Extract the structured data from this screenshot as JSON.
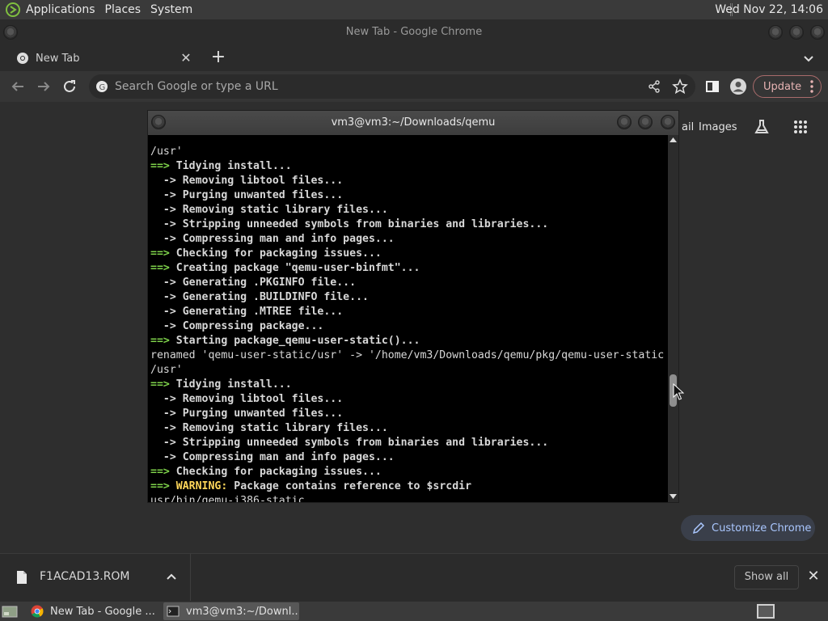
{
  "top_panel": {
    "menus": [
      "Applications",
      "Places",
      "System"
    ],
    "clock": "Wed Nov 22, 14:06"
  },
  "chrome": {
    "window_title": "New Tab - Google Chrome",
    "tab_title": "New Tab",
    "omnibox_placeholder": "Search Google or type a URL",
    "update_label": "Update",
    "gmail_fragment": "ail",
    "images_link": "Images",
    "customize_label": "Customize Chrome",
    "download": {
      "filename": "F1ACAD13.ROM",
      "show_all": "Show all"
    }
  },
  "terminal": {
    "title": "vm3@vm3:~/Downloads/qemu",
    "lines": [
      {
        "text": "                                                         ",
        "type": "plain"
      },
      {
        "text": "/usr'",
        "type": "plain"
      },
      {
        "text": "==> Tidying install...",
        "type": "step"
      },
      {
        "text": "  -> Removing libtool files...",
        "type": "sub"
      },
      {
        "text": "  -> Purging unwanted files...",
        "type": "sub"
      },
      {
        "text": "  -> Removing static library files...",
        "type": "sub"
      },
      {
        "text": "  -> Stripping unneeded symbols from binaries and libraries...",
        "type": "sub"
      },
      {
        "text": "  -> Compressing man and info pages...",
        "type": "sub"
      },
      {
        "text": "==> Checking for packaging issues...",
        "type": "step"
      },
      {
        "text": "==> Creating package \"qemu-user-binfmt\"...",
        "type": "step"
      },
      {
        "text": "  -> Generating .PKGINFO file...",
        "type": "sub"
      },
      {
        "text": "  -> Generating .BUILDINFO file...",
        "type": "sub"
      },
      {
        "text": "  -> Generating .MTREE file...",
        "type": "sub"
      },
      {
        "text": "  -> Compressing package...",
        "type": "sub"
      },
      {
        "text": "==> Starting package_qemu-user-static()...",
        "type": "step"
      },
      {
        "text": "renamed 'qemu-user-static/usr' -> '/home/vm3/Downloads/qemu/pkg/qemu-user-static",
        "type": "plain"
      },
      {
        "text": "/usr'",
        "type": "plain"
      },
      {
        "text": "==> Tidying install...",
        "type": "step"
      },
      {
        "text": "  -> Removing libtool files...",
        "type": "sub"
      },
      {
        "text": "  -> Purging unwanted files...",
        "type": "sub"
      },
      {
        "text": "  -> Removing static library files...",
        "type": "sub"
      },
      {
        "text": "  -> Stripping unneeded symbols from binaries and libraries...",
        "type": "sub"
      },
      {
        "text": "  -> Compressing man and info pages...",
        "type": "sub"
      },
      {
        "text": "==> Checking for packaging issues...",
        "type": "step"
      },
      {
        "text": "==> WARNING: Package contains reference to $srcdir",
        "type": "warning"
      },
      {
        "text": "usr/bin/qemu-i386-static",
        "type": "plain"
      }
    ]
  },
  "taskbar": {
    "tasks": [
      "New Tab - Google ...",
      "vm3@vm3:~/Downl..."
    ]
  }
}
